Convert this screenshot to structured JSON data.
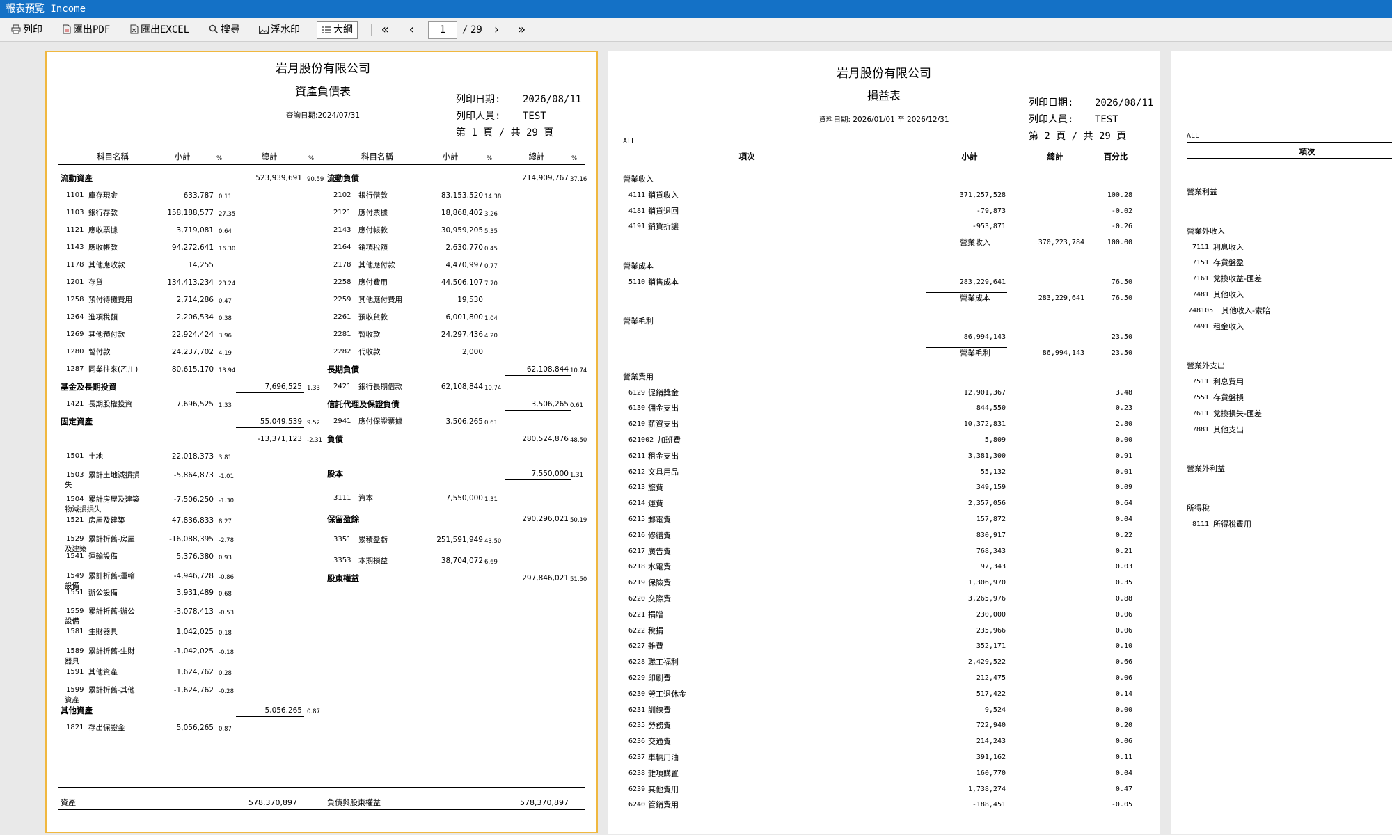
{
  "window": {
    "title": "報表預覧 Income"
  },
  "toolbar": {
    "print": "列印",
    "pdf": "匯出PDF",
    "excel": "匯出EXCEL",
    "search": "搜尋",
    "watermark": "浮水印",
    "outline": "大綱",
    "page_current": "1",
    "page_total_sep": "/",
    "page_total": "29",
    "first": "«",
    "prev": "‹",
    "next": "›",
    "last": "»"
  },
  "p1": {
    "company": "岩月股份有限公司",
    "title": "資產負債表",
    "query_date": "查詢日期:2024/07/31",
    "print_date_label": "列印日期:",
    "print_date": "2026/08/11",
    "printer_label": "列印人員:",
    "printer": "TEST",
    "page_no": "第 1 頁 / 共 29 頁",
    "headers": {
      "left_name": "科目名稱",
      "left_sub": "小計",
      "left_pct": "%",
      "left_total": "總計",
      "left_total_pct": "%",
      "right_name": "科目名稱",
      "right_sub": "小計",
      "right_pct": "%",
      "right_total": "總計",
      "right_total_pct": "%"
    },
    "left_rows": [
      {
        "kind": "group",
        "name": "流動資產",
        "total": "523,939,691",
        "pct": "90.59"
      },
      {
        "kind": "item",
        "code": "1101",
        "name": "庫存現金",
        "sub": "633,787",
        "pct": "0.11"
      },
      {
        "kind": "item",
        "code": "1103",
        "name": "銀行存款",
        "sub": "158,188,577",
        "pct": "27.35"
      },
      {
        "kind": "item",
        "code": "1121",
        "name": "應收票據",
        "sub": "3,719,081",
        "pct": "0.64"
      },
      {
        "kind": "item",
        "code": "1143",
        "name": "應收帳款",
        "sub": "94,272,641",
        "pct": "16.30"
      },
      {
        "kind": "item",
        "code": "1178",
        "name": "其他應收款",
        "sub": "14,255",
        "pct": ""
      },
      {
        "kind": "item",
        "code": "1201",
        "name": "存貨",
        "sub": "134,413,234",
        "pct": "23.24"
      },
      {
        "kind": "item",
        "code": "1258",
        "name": "預付待攤費用",
        "sub": "2,714,286",
        "pct": "0.47"
      },
      {
        "kind": "item",
        "code": "1264",
        "name": "進項稅額",
        "sub": "2,206,534",
        "pct": "0.38"
      },
      {
        "kind": "item",
        "code": "1269",
        "name": "其他預付款",
        "sub": "22,924,424",
        "pct": "3.96"
      },
      {
        "kind": "item",
        "code": "1280",
        "name": "暫付款",
        "sub": "24,237,702",
        "pct": "4.19"
      },
      {
        "kind": "item",
        "code": "1287",
        "name": "同業往來(乙川)",
        "sub": "80,615,170",
        "pct": "13.94"
      },
      {
        "kind": "group",
        "name": "基金及長期投資",
        "total": "7,696,525",
        "pct": "1.33"
      },
      {
        "kind": "item",
        "code": "1421",
        "name": "長期股權投資",
        "sub": "7,696,525",
        "pct": "1.33"
      },
      {
        "kind": "group",
        "name": "固定資產",
        "total": "55,049,539",
        "pct": "9.52"
      },
      {
        "kind": "extra",
        "total": "-13,371,123",
        "pct": "-2.31"
      },
      {
        "kind": "item",
        "code": "1501",
        "name": "土地",
        "sub": "22,018,373",
        "pct": "3.81"
      },
      {
        "kind": "item2",
        "code": "1503",
        "name": "累計土地減損損",
        "name2": "失",
        "sub": "-5,864,873",
        "pct": "-1.01"
      },
      {
        "kind": "item2",
        "code": "1504",
        "name": "累計房屋及建築",
        "name2": "物減損損失",
        "sub": "-7,506,250",
        "pct": "-1.30"
      },
      {
        "kind": "item",
        "code": "1521",
        "name": "房屋及建築",
        "sub": "47,836,833",
        "pct": "8.27"
      },
      {
        "kind": "item2",
        "code": "1529",
        "name": "累計折舊-房屋",
        "name2": "及建築",
        "sub": "-16,088,395",
        "pct": "-2.78"
      },
      {
        "kind": "item",
        "code": "1541",
        "name": "運輸設備",
        "sub": "5,376,380",
        "pct": "0.93"
      },
      {
        "kind": "item2",
        "code": "1549",
        "name": "累計折舊-運輸",
        "name2": "設備",
        "sub": "-4,946,728",
        "pct": "-0.86"
      },
      {
        "kind": "item",
        "code": "1551",
        "name": "辦公設備",
        "sub": "3,931,489",
        "pct": "0.68"
      },
      {
        "kind": "item2",
        "code": "1559",
        "name": "累計折舊-辦公",
        "name2": "設備",
        "sub": "-3,078,413",
        "pct": "-0.53"
      },
      {
        "kind": "item",
        "code": "1581",
        "name": "生財器具",
        "sub": "1,042,025",
        "pct": "0.18"
      },
      {
        "kind": "item2",
        "code": "1589",
        "name": "累計折舊-生財",
        "name2": "器具",
        "sub": "-1,042,025",
        "pct": "-0.18"
      },
      {
        "kind": "item",
        "code": "1591",
        "name": "其他資產",
        "sub": "1,624,762",
        "pct": "0.28"
      },
      {
        "kind": "item2",
        "code": "1599",
        "name": "累計折舊-其他",
        "name2": "資產",
        "sub": "-1,624,762",
        "pct": "-0.28"
      },
      {
        "kind": "group",
        "name": "其他資產",
        "total": "5,056,265",
        "pct": "0.87"
      },
      {
        "kind": "item",
        "code": "1821",
        "name": "存出保證金",
        "sub": "5,056,265",
        "pct": "0.87"
      }
    ],
    "right_rows": [
      {
        "kind": "group",
        "name": "流動負債",
        "total": "214,909,767",
        "pct": "37.16"
      },
      {
        "kind": "item",
        "code": "2102",
        "name": "銀行借款",
        "sub": "83,153,520",
        "pct": "14.38"
      },
      {
        "kind": "item",
        "code": "2121",
        "name": "應付票據",
        "sub": "18,868,402",
        "pct": "3.26"
      },
      {
        "kind": "item",
        "code": "2143",
        "name": "應付帳款",
        "sub": "30,959,205",
        "pct": "5.35"
      },
      {
        "kind": "item",
        "code": "2164",
        "name": "銷項稅額",
        "sub": "2,630,770",
        "pct": "0.45"
      },
      {
        "kind": "item",
        "code": "2178",
        "name": "其他應付款",
        "sub": "4,470,997",
        "pct": "0.77"
      },
      {
        "kind": "item",
        "code": "2258",
        "name": "應付費用",
        "sub": "44,506,107",
        "pct": "7.70"
      },
      {
        "kind": "item",
        "code": "2259",
        "name": "其他應付費用",
        "sub": "19,530",
        "pct": ""
      },
      {
        "kind": "item",
        "code": "2261",
        "name": "預收貨款",
        "sub": "6,001,800",
        "pct": "1.04"
      },
      {
        "kind": "item",
        "code": "2281",
        "name": "暫收款",
        "sub": "24,297,436",
        "pct": "4.20"
      },
      {
        "kind": "item",
        "code": "2282",
        "name": "代收款",
        "sub": "2,000",
        "pct": ""
      },
      {
        "kind": "group",
        "name": "長期負債",
        "total": "62,108,844",
        "pct": "10.74"
      },
      {
        "kind": "item",
        "code": "2421",
        "name": "銀行長期借款",
        "sub": "62,108,844",
        "pct": "10.74"
      },
      {
        "kind": "group",
        "name": "信託代理及保證負債",
        "total": "3,506,265",
        "pct": "0.61"
      },
      {
        "kind": "item",
        "code": "2941",
        "name": "應付保證票據",
        "sub": "3,506,265",
        "pct": "0.61"
      },
      {
        "kind": "group",
        "name": "負債",
        "total": "280,524,876",
        "pct": "48.50"
      },
      {
        "kind": "group",
        "name": "股本",
        "total": "7,550,000",
        "pct": "1.31"
      },
      {
        "kind": "item",
        "code": "3111",
        "name": "資本",
        "sub": "7,550,000",
        "pct": "1.31"
      },
      {
        "kind": "group",
        "name": "保留盈餘",
        "total": "290,296,021",
        "pct": "50.19"
      },
      {
        "kind": "item",
        "code": "3351",
        "name": "累積盈虧",
        "sub": "251,591,949",
        "pct": "43.50"
      },
      {
        "kind": "item",
        "code": "3353",
        "name": "本期損益",
        "sub": "38,704,072",
        "pct": "6.69"
      },
      {
        "kind": "group",
        "name": "股東權益",
        "total": "297,846,021",
        "pct": "51.50"
      }
    ],
    "footer": {
      "left_label": "資產",
      "left_total": "578,370,897",
      "right_label": "負債與股東權益",
      "right_total": "578,370,897"
    }
  },
  "p2": {
    "company": "岩月股份有限公司",
    "title": "損益表",
    "data_date": "資料日期: 2026/01/01 至 2026/12/31",
    "print_date_label": "列印日期:",
    "print_date": "2026/08/11",
    "printer_label": "列印人員:",
    "printer": "TEST",
    "page_no": "第 2 頁 / 共 29 頁",
    "scope": "ALL",
    "headers": {
      "item": "項次",
      "sub": "小計",
      "total": "總計",
      "pct": "百分比"
    },
    "rows": [
      {
        "kind": "section",
        "name": "營業收入"
      },
      {
        "kind": "item",
        "code": "4111",
        "name": "銷貨收入",
        "sub": "371,257,528",
        "pct": "100.28"
      },
      {
        "kind": "item",
        "code": "4181",
        "name": "銷貨退回",
        "sub": "-79,873",
        "pct": "-0.02"
      },
      {
        "kind": "item",
        "code": "4191",
        "name": "銷貨折讓",
        "sub": "-953,871",
        "pct": "-0.26"
      },
      {
        "kind": "total",
        "name": "營業收入",
        "total": "370,223,784",
        "pct": "100.00"
      },
      {
        "kind": "section",
        "name": "營業成本"
      },
      {
        "kind": "item",
        "code": "5110",
        "name": "銷售成本",
        "sub": "283,229,641",
        "pct": "76.50"
      },
      {
        "kind": "total",
        "name": "營業成本",
        "total": "283,229,641",
        "pct": "76.50"
      },
      {
        "kind": "section",
        "name": "營業毛利"
      },
      {
        "kind": "item",
        "code": "",
        "name": "",
        "sub": "86,994,143",
        "pct": "23.50"
      },
      {
        "kind": "total",
        "name": "營業毛利",
        "total": "86,994,143",
        "pct": "23.50"
      },
      {
        "kind": "section",
        "name": "營業費用"
      },
      {
        "kind": "item",
        "code": "6129",
        "name": "促銷獎金",
        "sub": "12,901,367",
        "pct": "3.48"
      },
      {
        "kind": "item",
        "code": "6130",
        "name": "佣金支出",
        "sub": "844,550",
        "pct": "0.23"
      },
      {
        "kind": "item",
        "code": "6210",
        "name": "薪資支出",
        "sub": "10,372,831",
        "pct": "2.80"
      },
      {
        "kind": "item",
        "code": "621002",
        "name": "加班費",
        "sub": "5,809",
        "pct": "0.00"
      },
      {
        "kind": "item",
        "code": "6211",
        "name": "租金支出",
        "sub": "3,381,300",
        "pct": "0.91"
      },
      {
        "kind": "item",
        "code": "6212",
        "name": "文具用品",
        "sub": "55,132",
        "pct": "0.01"
      },
      {
        "kind": "item",
        "code": "6213",
        "name": "旅費",
        "sub": "349,159",
        "pct": "0.09"
      },
      {
        "kind": "item",
        "code": "6214",
        "name": "運費",
        "sub": "2,357,056",
        "pct": "0.64"
      },
      {
        "kind": "item",
        "code": "6215",
        "name": "郵電費",
        "sub": "157,872",
        "pct": "0.04"
      },
      {
        "kind": "item",
        "code": "6216",
        "name": "修繕費",
        "sub": "830,917",
        "pct": "0.22"
      },
      {
        "kind": "item",
        "code": "6217",
        "name": "廣告費",
        "sub": "768,343",
        "pct": "0.21"
      },
      {
        "kind": "item",
        "code": "6218",
        "name": "水電費",
        "sub": "97,343",
        "pct": "0.03"
      },
      {
        "kind": "item",
        "code": "6219",
        "name": "保險費",
        "sub": "1,306,970",
        "pct": "0.35"
      },
      {
        "kind": "item",
        "code": "6220",
        "name": "交際費",
        "sub": "3,265,976",
        "pct": "0.88"
      },
      {
        "kind": "item",
        "code": "6221",
        "name": "捐贈",
        "sub": "230,000",
        "pct": "0.06"
      },
      {
        "kind": "item",
        "code": "6222",
        "name": "稅捐",
        "sub": "235,966",
        "pct": "0.06"
      },
      {
        "kind": "item",
        "code": "6227",
        "name": "雜費",
        "sub": "352,171",
        "pct": "0.10"
      },
      {
        "kind": "item",
        "code": "6228",
        "name": "職工福利",
        "sub": "2,429,522",
        "pct": "0.66"
      },
      {
        "kind": "item",
        "code": "6229",
        "name": "印刷費",
        "sub": "212,475",
        "pct": "0.06"
      },
      {
        "kind": "item",
        "code": "6230",
        "name": "勞工退休金",
        "sub": "517,422",
        "pct": "0.14"
      },
      {
        "kind": "item",
        "code": "6231",
        "name": "訓練費",
        "sub": "9,524",
        "pct": "0.00"
      },
      {
        "kind": "item",
        "code": "6235",
        "name": "勞務費",
        "sub": "722,940",
        "pct": "0.20"
      },
      {
        "kind": "item",
        "code": "6236",
        "name": "交通費",
        "sub": "214,243",
        "pct": "0.06"
      },
      {
        "kind": "item",
        "code": "6237",
        "name": "車輛用油",
        "sub": "391,162",
        "pct": "0.11"
      },
      {
        "kind": "item",
        "code": "6238",
        "name": "雜項購置",
        "sub": "160,770",
        "pct": "0.04"
      },
      {
        "kind": "item",
        "code": "6239",
        "name": "其他費用",
        "sub": "1,738,274",
        "pct": "0.47"
      },
      {
        "kind": "item",
        "code": "6240",
        "name": "管銷費用",
        "sub": "-188,451",
        "pct": "-0.05"
      }
    ]
  },
  "p3": {
    "scope": "ALL",
    "header_item": "項次",
    "rows": [
      {
        "kind": "section",
        "name": "營業利益"
      },
      {
        "kind": "section",
        "name": "營業外收入"
      },
      {
        "kind": "item",
        "code": "7111",
        "name": "利息收入"
      },
      {
        "kind": "item",
        "code": "7151",
        "name": "存貨盤盈"
      },
      {
        "kind": "item",
        "code": "7161",
        "name": "兌換收益-匯差"
      },
      {
        "kind": "item",
        "code": "7481",
        "name": "其他收入"
      },
      {
        "kind": "item",
        "code": "748105",
        "name": "其他收入-索賠"
      },
      {
        "kind": "item",
        "code": "7491",
        "name": "租金收入"
      },
      {
        "kind": "section",
        "name": "營業外支出"
      },
      {
        "kind": "item",
        "code": "7511",
        "name": "利息費用"
      },
      {
        "kind": "item",
        "code": "7551",
        "name": "存貨盤損"
      },
      {
        "kind": "item",
        "code": "7611",
        "name": "兌換損失-匯差"
      },
      {
        "kind": "item",
        "code": "7881",
        "name": "其他支出"
      },
      {
        "kind": "section",
        "name": "營業外利益"
      },
      {
        "kind": "section",
        "name": "所得稅"
      },
      {
        "kind": "item",
        "code": "8111",
        "name": "所得稅費用"
      }
    ]
  }
}
